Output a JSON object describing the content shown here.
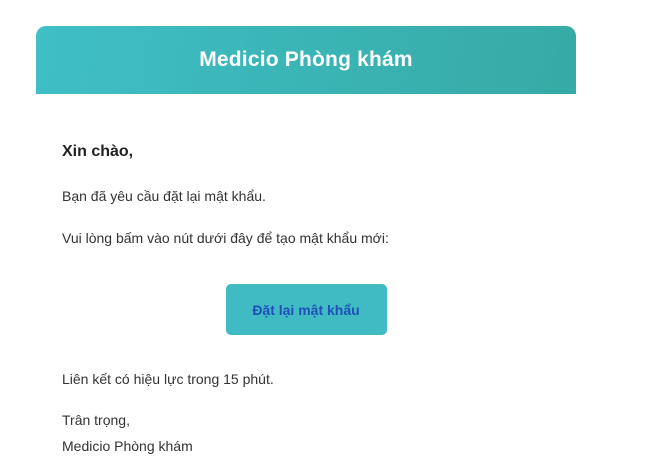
{
  "colors": {
    "header_start": "#3fbfc6",
    "header_end": "#36aaa5",
    "button_bg": "#40bbc3",
    "button_text": "#1f4fb8"
  },
  "header": {
    "title": "Medicio Phòng khám"
  },
  "body": {
    "greeting": "Xin chào,",
    "line1": "Bạn đã yêu cầu đặt lại mật khẩu.",
    "line2": "Vui lòng bấm vào nút dưới đây để tạo mật khẩu mới:",
    "button_label": "Đặt lại mật khẩu",
    "expiry_note": "Liên kết có hiệu lực trong 15 phút.",
    "signoff": "Trân trọng,",
    "signature": "Medicio Phòng khám"
  }
}
